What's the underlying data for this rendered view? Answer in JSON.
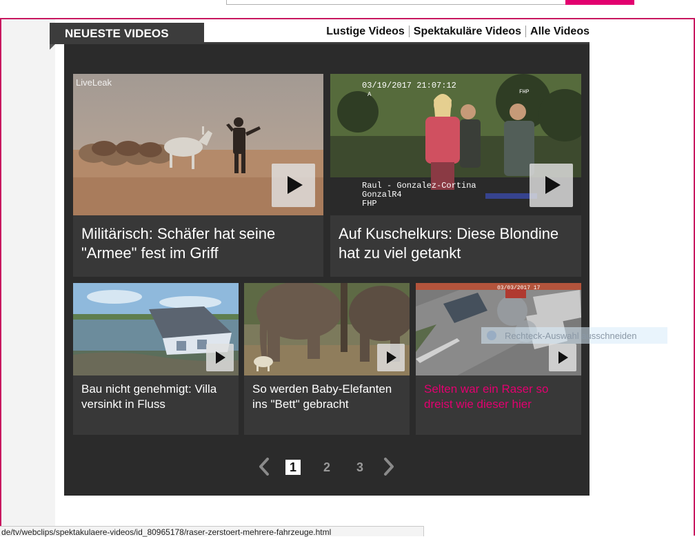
{
  "header": {
    "section_title": "NEUESTE VIDEOS",
    "links": [
      "Lustige Videos",
      "Spektakuläre Videos",
      "Alle Videos"
    ]
  },
  "videos": [
    {
      "title": "Militärisch: Schäfer hat seine \"Armee\" fest im Griff",
      "overlay": "LiveLeak"
    },
    {
      "title": "Auf Kuschelkurs: Diese Blondine hat zu viel getankt",
      "overlay_lines": [
        "03/19/2017  21:07:12",
        "A",
        "FHP",
        "Raul - Gonzalez-Cortina",
        "GonzalR4",
        "FHP"
      ]
    },
    {
      "title": "Bau nicht genehmigt: Villa versinkt in Fluss"
    },
    {
      "title": "So werden Baby-Elefanten ins \"Bett\" gebracht"
    },
    {
      "title": "Selten war ein Raser so dreist wie dieser hier",
      "overlay": "03/03/2017 17"
    }
  ],
  "pagination": {
    "pages": [
      "1",
      "2",
      "3"
    ],
    "current": "1"
  },
  "tooltip_text": "Rechteck-Auswahl ausschneiden",
  "status_url": "de/tv/webclips/spektakulaere-videos/id_80965178/raser-zerstoert-mehrere-fahrzeuge.html",
  "colors": {
    "accent": "#e2006f",
    "panel": "#2b2b2b",
    "card": "#383838",
    "frame": "#c8175f"
  },
  "icons": [
    "play-icon",
    "chevron-left-icon",
    "chevron-right-icon"
  ]
}
